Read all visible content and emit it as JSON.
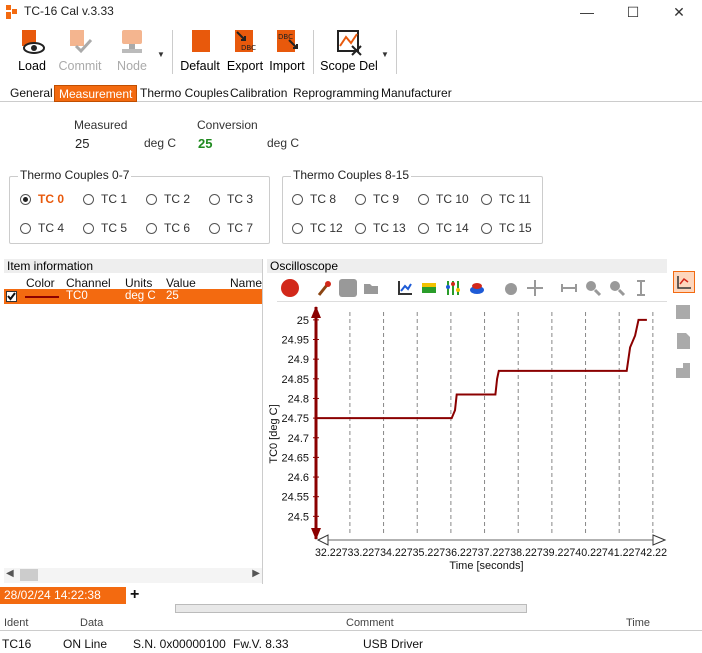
{
  "window": {
    "title": "TC-16 Cal v.3.33",
    "minimize": "—",
    "maximize": "☐",
    "close": "✕"
  },
  "toolbar": {
    "load": "Load",
    "commit": "Commit",
    "node": "Node",
    "default": "Default",
    "export": "Export",
    "import": "Import",
    "scope_del": "Scope Del",
    "export_badge": "DBC",
    "import_badge": "DBC"
  },
  "tabs": [
    "General",
    "Measurement",
    "Thermo Couples",
    "Calibration",
    "Reprogramming",
    "Manufacturer"
  ],
  "measurement": {
    "measured_label": "Measured",
    "measured_value": "25",
    "measured_unit": "deg C",
    "conversion_label": "Conversion",
    "conversion_value": "25",
    "conversion_unit": "deg C"
  },
  "tc_group_a": {
    "title": "Thermo Couples 0-7",
    "items": [
      "TC 0",
      "TC 1",
      "TC 2",
      "TC 3",
      "TC 4",
      "TC 5",
      "TC 6",
      "TC 7"
    ],
    "selected": "TC 0"
  },
  "tc_group_b": {
    "title": "Thermo Couples 8-15",
    "items": [
      "TC 8",
      "TC 9",
      "TC 10",
      "TC 11",
      "TC 12",
      "TC 13",
      "TC 14",
      "TC 15"
    ]
  },
  "item_info": {
    "title": "Item information",
    "columns": [
      "Color",
      "Channel",
      "Units",
      "Value",
      "Name"
    ],
    "rows": [
      {
        "checked": true,
        "channel": "TC0",
        "units": "deg C",
        "value": "25",
        "name": ""
      }
    ]
  },
  "oscilloscope": {
    "title": "Oscilloscope"
  },
  "chart_data": {
    "type": "line",
    "xlabel": "Time [seconds]",
    "ylabel": "TC0  [deg C]",
    "ylim": [
      24.45,
      25.02
    ],
    "xlim": [
      32.22,
      42.35
    ],
    "y_ticks": [
      "25",
      "24.95",
      "24.9",
      "24.85",
      "24.8",
      "24.75",
      "24.7",
      "24.65",
      "24.6",
      "24.55",
      "24.5"
    ],
    "x_ticks_text": "32.22733.22734.22735.22736.22737.22738.22739.22740.22741.22742.22",
    "grid": "vertical dashed",
    "series": [
      {
        "color": "#8b0000",
        "points": [
          [
            32.22,
            24.75
          ],
          [
            36.25,
            24.75
          ],
          [
            36.35,
            24.77
          ],
          [
            36.4,
            24.81
          ],
          [
            37.55,
            24.81
          ],
          [
            37.6,
            24.85
          ],
          [
            37.65,
            24.87
          ],
          [
            41.45,
            24.87
          ],
          [
            41.55,
            24.93
          ],
          [
            41.7,
            24.96
          ],
          [
            41.8,
            25.0
          ],
          [
            42.05,
            25.0
          ]
        ]
      }
    ]
  },
  "log": {
    "session_tab": "28/02/24 14:22:38",
    "add_tab": "+",
    "columns": [
      "Ident",
      "Data",
      "Comment",
      "Time"
    ]
  },
  "status": {
    "device": "TC16",
    "state": "ON Line",
    "serial": "S.N. 0x00000100",
    "fw": "Fw.V. 8.33",
    "driver": "USB Driver"
  },
  "colors": {
    "accent": "#f36a10",
    "trace": "#8b0000",
    "green": "#1f8a1f"
  }
}
